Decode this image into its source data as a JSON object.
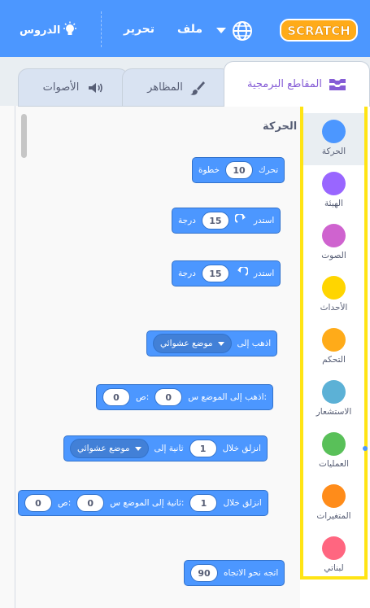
{
  "menubar": {
    "logo_text": "SCRATCH",
    "file": "ملف",
    "edit": "تحرير",
    "tutorials": "الدروس"
  },
  "tabs": {
    "code": "المقاطع البرمجية",
    "costumes": "المظاهر",
    "sounds": "الأصوات"
  },
  "palette": {
    "section_title": "الحركة"
  },
  "categories": [
    {
      "label": "الحركة",
      "color": "#4c97ff",
      "selected": true
    },
    {
      "label": "الهيئة",
      "color": "#9966ff"
    },
    {
      "label": "الصوت",
      "color": "#cf63cf"
    },
    {
      "label": "الأحداث",
      "color": "#ffd500"
    },
    {
      "label": "التحكم",
      "color": "#ffab19"
    },
    {
      "label": "الاستشعار",
      "color": "#5cb1d6"
    },
    {
      "label": "العمليات",
      "color": "#59c059"
    },
    {
      "label": "المتغيرات",
      "color": "#ff8c1a"
    },
    {
      "label": "لبناتي",
      "color": "#ff6680"
    }
  ],
  "blocks": {
    "move": {
      "pre": "تحرك",
      "value": "10",
      "post": "خطوة"
    },
    "turn_right": {
      "pre": "استدر",
      "value": "15",
      "post": "درجة"
    },
    "turn_left": {
      "pre": "استدر",
      "value": "15",
      "post": "درجة"
    },
    "goto": {
      "pre": "اذهب إلى",
      "menu": "موضع عشوائي"
    },
    "goto_xy": {
      "pre": "اذهب إلى الموضع س:",
      "x": "0",
      "mid": "ص:",
      "y": "0"
    },
    "glide_to": {
      "pre": "انزلق خلال",
      "secs": "1",
      "mid": "ثانية إلى",
      "menu": "موضع عشوائي"
    },
    "glide_xy": {
      "pre": "انزلق خلال",
      "secs": "1",
      "mid": "ثانية إلى الموضع س:",
      "x": "0",
      "mid2": "ص:",
      "y": "0"
    },
    "point_dir": {
      "pre": "اتجه نحو الاتجاه",
      "value": "90"
    }
  },
  "colors": {
    "menubar": "#4c97ff",
    "motion": "#4c97ff",
    "highlight_border": "#ffe414"
  }
}
